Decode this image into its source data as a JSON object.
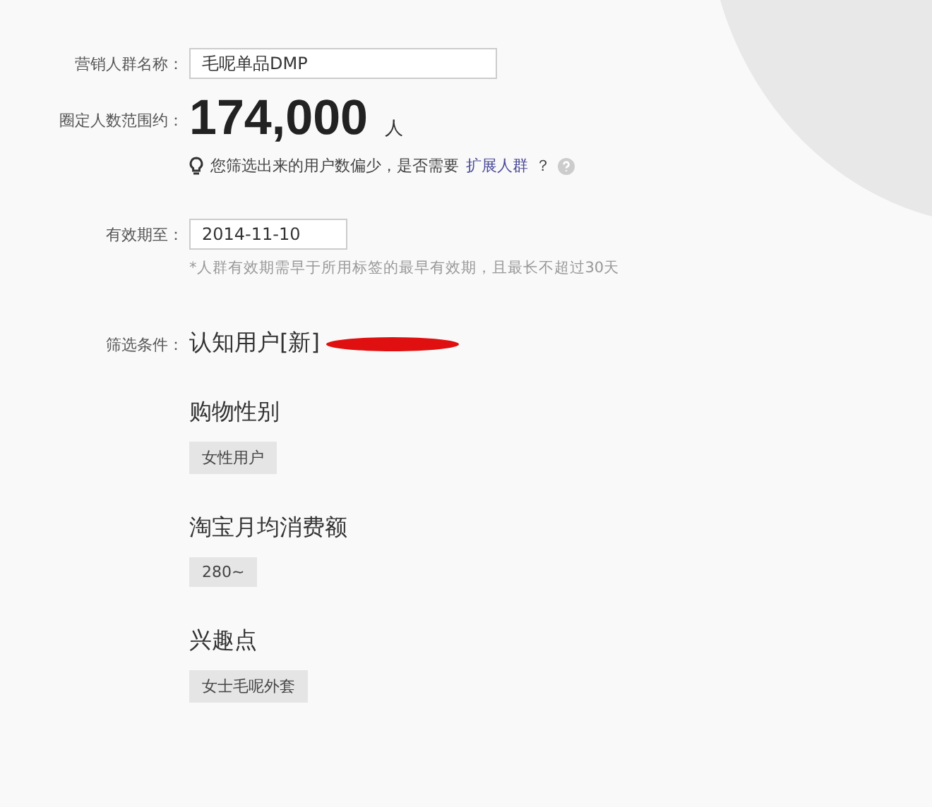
{
  "name_field": {
    "label": "营销人群名称：",
    "value": "毛呢单品DMP"
  },
  "audience": {
    "label": "圈定人数范围约：",
    "count": "174,000",
    "unit": "人",
    "tip": "您筛选出来的用户数偏少，是否需要",
    "tip_link": "扩展人群",
    "tip_end": "？"
  },
  "expiry": {
    "label": "有效期至：",
    "value": "2014-11-10",
    "note": "*人群有效期需早于所用标签的最早有效期，且最长不超过30天"
  },
  "filter": {
    "label": "筛选条件：",
    "title": "认知用户[新]",
    "redacted": true,
    "groups": [
      {
        "title": "购物性别",
        "tags": [
          "女性用户"
        ]
      },
      {
        "title": "淘宝月均消费额",
        "tags": [
          "280~"
        ]
      },
      {
        "title": "兴趣点",
        "tags": [
          "女士毛呢外套"
        ]
      }
    ]
  }
}
